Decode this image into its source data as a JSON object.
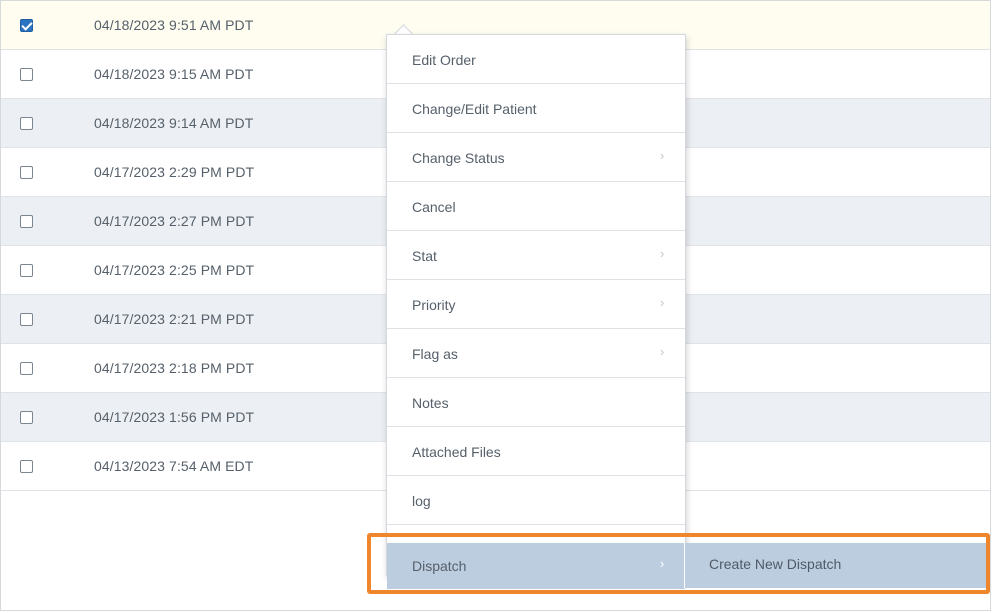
{
  "orders": [
    {
      "date": "04/18/2023 9:51 AM PDT",
      "checked": true
    },
    {
      "date": "04/18/2023 9:15 AM PDT",
      "checked": false
    },
    {
      "date": "04/18/2023 9:14 AM PDT",
      "checked": false
    },
    {
      "date": "04/17/2023 2:29 PM PDT",
      "checked": false
    },
    {
      "date": "04/17/2023 2:27 PM PDT",
      "checked": false
    },
    {
      "date": "04/17/2023 2:25 PM PDT",
      "checked": false
    },
    {
      "date": "04/17/2023 2:21 PM PDT",
      "checked": false
    },
    {
      "date": "04/17/2023 2:18 PM PDT",
      "checked": false
    },
    {
      "date": "04/17/2023 1:56 PM PDT",
      "checked": false
    },
    {
      "date": "04/13/2023 7:54 AM EDT",
      "checked": false
    }
  ],
  "context_menu": {
    "items": [
      {
        "label": "Edit Order",
        "submenu": false
      },
      {
        "label": "Change/Edit Patient",
        "submenu": false
      },
      {
        "label": "Change Status",
        "submenu": true
      },
      {
        "label": "Cancel",
        "submenu": false
      },
      {
        "label": "Stat",
        "submenu": true
      },
      {
        "label": "Priority",
        "submenu": true
      },
      {
        "label": "Flag as",
        "submenu": true
      },
      {
        "label": "Notes",
        "submenu": false
      },
      {
        "label": "Attached Files",
        "submenu": false
      },
      {
        "label": "log",
        "submenu": false
      },
      {
        "label": "Dispatch",
        "submenu": true,
        "active": true
      }
    ],
    "arrow_glyph": "›"
  },
  "submenu": {
    "items": [
      {
        "label": "Create New Dispatch"
      }
    ]
  },
  "colors": {
    "selected_row": "#fefdf0",
    "alt_row": "#eceff3",
    "menu_active": "#bccde0",
    "highlight": "#f0862b",
    "checkbox_checked": "#2a74c2"
  }
}
